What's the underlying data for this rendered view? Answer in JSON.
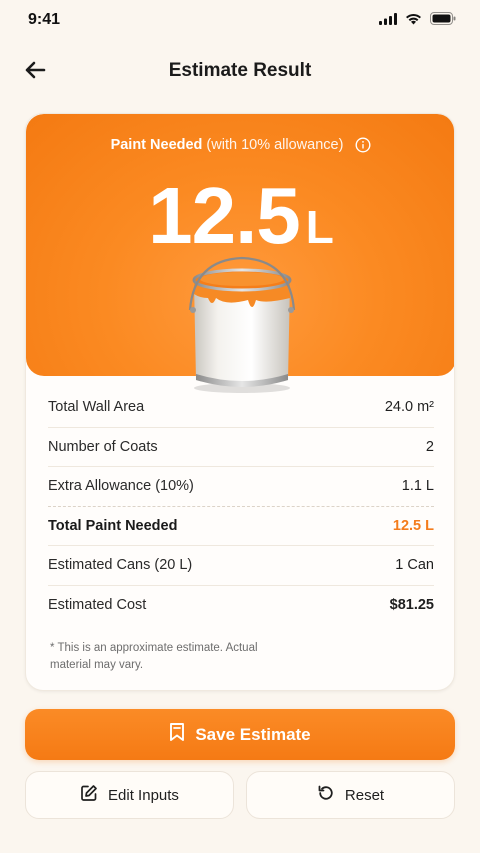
{
  "status": {
    "time": "9:41"
  },
  "header": {
    "title": "Estimate Result"
  },
  "hero": {
    "label_strong": "Paint Needed",
    "label_light": "(with 10% allowance)",
    "value": "12.5",
    "unit": "L"
  },
  "summary": [
    {
      "label": "Total Wall Area",
      "value": "24.0 m²"
    },
    {
      "label": "Number of Coats",
      "value": "2"
    },
    {
      "label": "Extra Allowance (10%)",
      "value": "1.1 L"
    },
    {
      "label": "Total Paint Needed",
      "value": "12.5 L"
    },
    {
      "label": "Estimated Cans (20 L)",
      "value": "1 Can"
    },
    {
      "label": "Estimated Cost",
      "value": "$81.25"
    }
  ],
  "note": "* This is an approximate estimate. Actual material may vary.",
  "actions": {
    "save_label": "Save Estimate",
    "edit_label": "Edit Inputs",
    "reset_label": "Reset"
  },
  "colors": {
    "accent": "#f57a14",
    "background": "#fbf6ef"
  }
}
